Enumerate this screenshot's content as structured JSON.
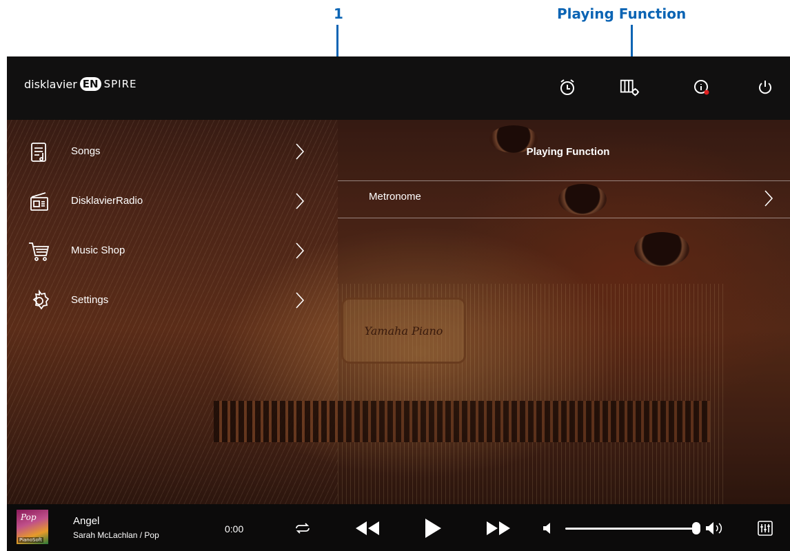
{
  "annotations": {
    "callout_1": "1",
    "callout_playing_function": "Playing Function"
  },
  "brand": {
    "prefix": "disklavier",
    "badge": "EN",
    "suffix": "SPIRE"
  },
  "topbar_icons": [
    "alarm-clock-icon",
    "playing-function-icon",
    "info-icon",
    "power-icon"
  ],
  "sidebar": {
    "items": [
      {
        "label": "Songs",
        "icon": "songs-icon"
      },
      {
        "label": "DisklavierRadio",
        "icon": "radio-icon"
      },
      {
        "label": "Music Shop",
        "icon": "cart-icon"
      },
      {
        "label": "Settings",
        "icon": "gear-icon"
      }
    ]
  },
  "panel": {
    "title": "Playing Function",
    "items": [
      {
        "label": "Metronome"
      }
    ]
  },
  "background": {
    "crest_text": "Yamaha Piano"
  },
  "player": {
    "album_genre": "Pop",
    "album_brand": "PianoSoft",
    "song_title": "Angel",
    "song_artist": "Sarah McLachlan / Pop",
    "time": "0:00",
    "volume": 1.0
  },
  "colors": {
    "callout_blue": "#0b64b4",
    "topbar": "#111010",
    "player_bar": "#0c0b0b",
    "info_dot": "#e02020"
  }
}
